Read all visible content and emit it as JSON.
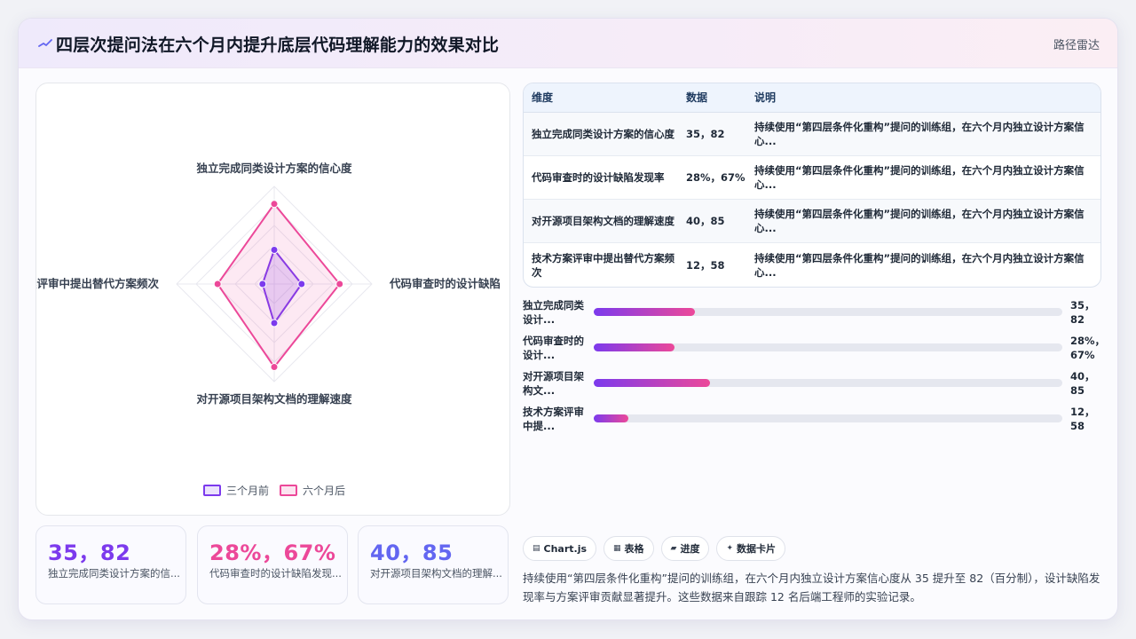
{
  "header": {
    "title": "四层次提问法在六个月内提升底层代码理解能力的效果对比",
    "tag": "路径雷达"
  },
  "chart_data": {
    "type": "radar",
    "axes": [
      "独立完成同类设计方案的信心度",
      "代码审查时的设计缺陷",
      "对开源项目架构文档的理解速度",
      "案评审中提出替代方案频次"
    ],
    "series": [
      {
        "name": "三个月前",
        "values": [
          35,
          28,
          40,
          12
        ],
        "color": "#7c3aed"
      },
      {
        "name": "六个月后",
        "values": [
          82,
          67,
          85,
          58
        ],
        "color": "#ec4899"
      }
    ],
    "rmax": 100,
    "grid_levels": 5,
    "legend_position": "bottom"
  },
  "stats": [
    {
      "value": "35，82",
      "label": "独立完成同类设计方案的信...",
      "color": "#7c3aed"
    },
    {
      "value": "28%，67%",
      "label": "代码审查时的设计缺陷发现...",
      "color": "#ec4899"
    },
    {
      "value": "40，85",
      "label": "对开源项目架构文档的理解...",
      "color": "#6366f1"
    }
  ],
  "table": {
    "headers": [
      "维度",
      "数据",
      "说明"
    ],
    "rows": [
      {
        "dim": "独立完成同类设计方案的信心度",
        "data": "35，82",
        "desc": "持续使用“第四层条件化重构”提问的训练组，在六个月内独立设计方案信心..."
      },
      {
        "dim": "代码审查时的设计缺陷发现率",
        "data": "28%，67%",
        "desc": "持续使用“第四层条件化重构”提问的训练组，在六个月内独立设计方案信心..."
      },
      {
        "dim": "对开源项目架构文档的理解速度",
        "data": "40，85",
        "desc": "持续使用“第四层条件化重构”提问的训练组，在六个月内独立设计方案信心..."
      },
      {
        "dim": "技术方案评审中提出替代方案频次",
        "data": "12，58",
        "desc": "持续使用“第四层条件化重构”提问的训练组，在六个月内独立设计方案信心..."
      }
    ]
  },
  "progress": [
    {
      "label": "独立完成同类设计...",
      "value": "35，82",
      "fraction": 0.216
    },
    {
      "label": "代码审查时的设计...",
      "value": "28%，67%",
      "fraction": 0.172
    },
    {
      "label": "对开源项目架构文...",
      "value": "40，85",
      "fraction": 0.249
    },
    {
      "label": "技术方案评审中提...",
      "value": "12，58",
      "fraction": 0.073
    }
  ],
  "chips": [
    {
      "icon": "▤",
      "label": "Chart.js"
    },
    {
      "icon": "▦",
      "label": "表格"
    },
    {
      "icon": "▰",
      "label": "进度"
    },
    {
      "icon": "✦",
      "label": "数据卡片"
    }
  ],
  "summary": "持续使用“第四层条件化重构”提问的训练组，在六个月内独立设计方案信心度从 35 提升至 82（百分制），设计缺陷发现率与方案评审贡献显著提升。这些数据来自跟踪 12 名后端工程师的实验记录。"
}
